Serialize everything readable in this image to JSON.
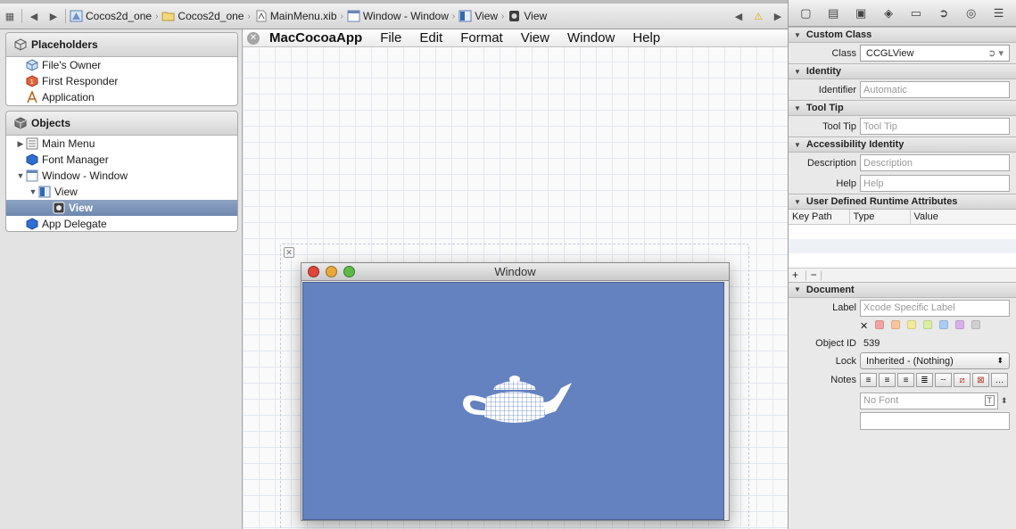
{
  "jumpbar": {
    "breadcrumbs": [
      "Cocos2d_one",
      "Cocos2d_one",
      "MainMenu.xib",
      "Window - Window",
      "View",
      "View"
    ]
  },
  "placeholders": {
    "title": "Placeholders",
    "items": [
      "File's Owner",
      "First Responder",
      "Application"
    ]
  },
  "objects": {
    "title": "Objects",
    "items": [
      "Main Menu",
      "Font Manager",
      "Window - Window",
      "View",
      "View",
      "App Delegate"
    ]
  },
  "canvas": {
    "menu": [
      "MacCocoaApp",
      "File",
      "Edit",
      "Format",
      "View",
      "Window",
      "Help"
    ],
    "window_title": "Window"
  },
  "inspector": {
    "custom_class": {
      "title": "Custom Class",
      "class_label": "Class",
      "class_value": "CCGLView"
    },
    "identity": {
      "title": "Identity",
      "identifier_label": "Identifier",
      "identifier_placeholder": "Automatic"
    },
    "tool_tip": {
      "title": "Tool Tip",
      "label": "Tool Tip",
      "placeholder": "Tool Tip"
    },
    "accessibility": {
      "title": "Accessibility Identity",
      "description_label": "Description",
      "description_placeholder": "Description",
      "help_label": "Help",
      "help_placeholder": "Help"
    },
    "runtime": {
      "title": "User Defined Runtime Attributes",
      "columns": [
        "Key Path",
        "Type",
        "Value"
      ],
      "add": "+",
      "remove": "−"
    },
    "document": {
      "title": "Document",
      "label_label": "Label",
      "label_placeholder": "Xcode Specific Label",
      "label_colors": [
        "#f3a3a3",
        "#f7c59a",
        "#f3ea9a",
        "#d8eea0",
        "#a9cdf3",
        "#d8b1ec",
        "#cfcfcf"
      ],
      "object_id_label": "Object ID",
      "object_id": "539",
      "lock_label": "Lock",
      "lock_value": "Inherited - (Nothing)",
      "notes_label": "Notes",
      "font_placeholder": "No Font"
    }
  }
}
